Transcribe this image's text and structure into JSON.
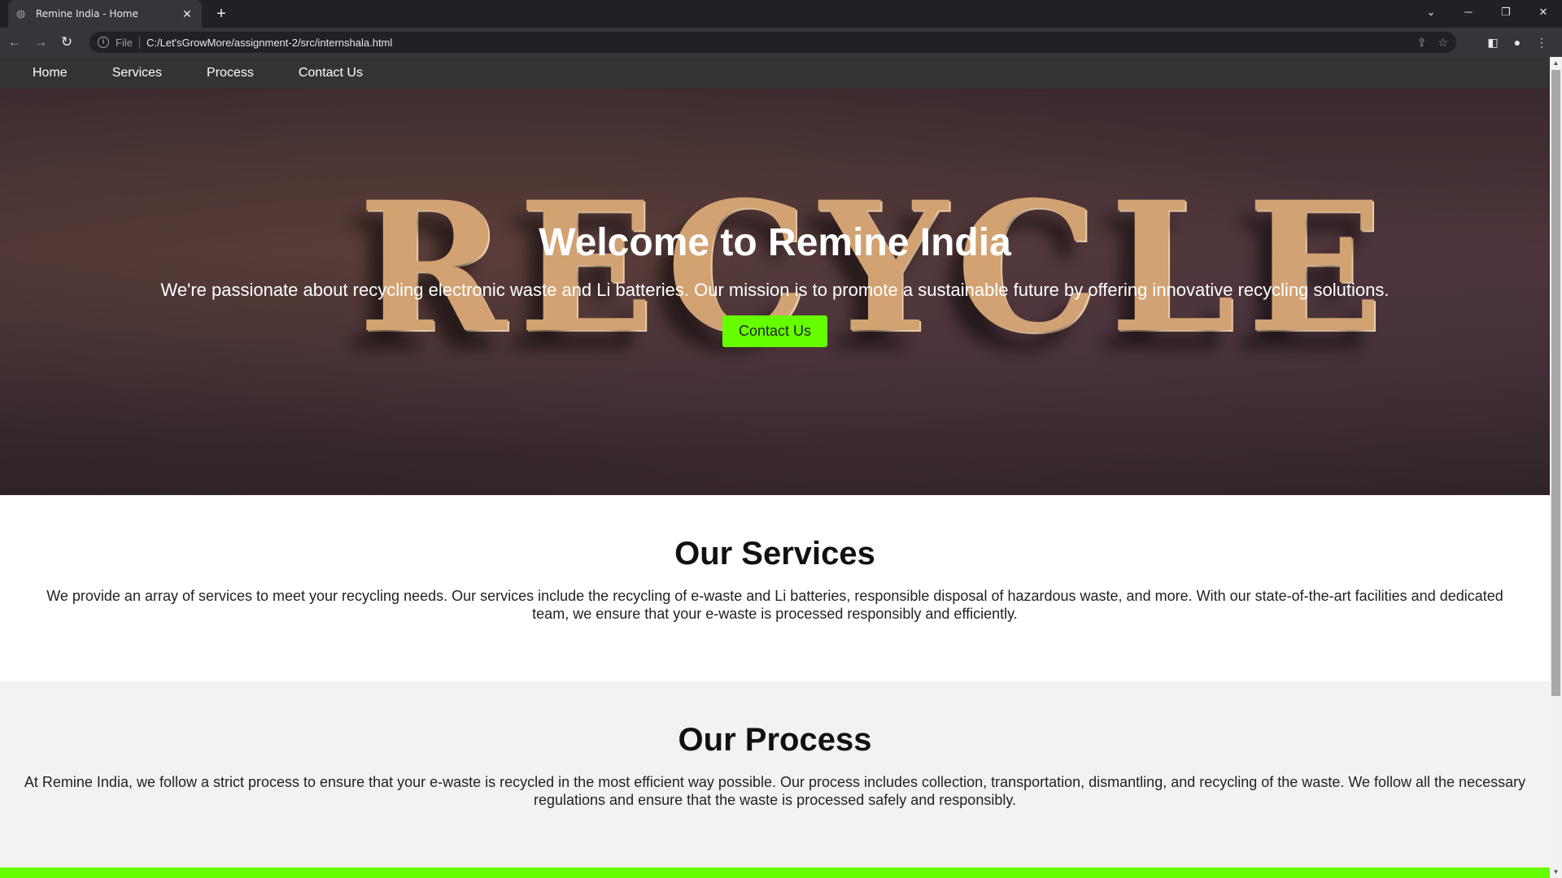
{
  "browser": {
    "tab_title": "Remine India - Home",
    "scheme_label": "File",
    "url": "C:/Let'sGrowMore/assignment-2/src/internshala.html"
  },
  "nav": {
    "items": [
      "Home",
      "Services",
      "Process",
      "Contact Us"
    ]
  },
  "hero": {
    "background_word": "RECYCLE",
    "title": "Welcome to Remine India",
    "tagline": "We're passionate about recycling electronic waste and Li batteries. Our mission is to promote a sustainable future by offering innovative recycling solutions.",
    "cta_label": "Contact Us"
  },
  "services": {
    "heading": "Our Services",
    "body": "We provide an array of services to meet your recycling needs. Our services include the recycling of e-waste and Li batteries, responsible disposal of hazardous waste, and more. With our state-of-the-art facilities and dedicated team, we ensure that your e-waste is processed responsibly and efficiently."
  },
  "process": {
    "heading": "Our Process",
    "body": "At Remine India, we follow a strict process to ensure that your e-waste is recycled in the most efficient way possible. Our process includes collection, transportation, dismantling, and recycling of the waste. We follow all the necessary regulations and ensure that the waste is processed safely and responsibly."
  },
  "colors": {
    "accent": "#66ff00",
    "nav_bg": "#333333"
  }
}
